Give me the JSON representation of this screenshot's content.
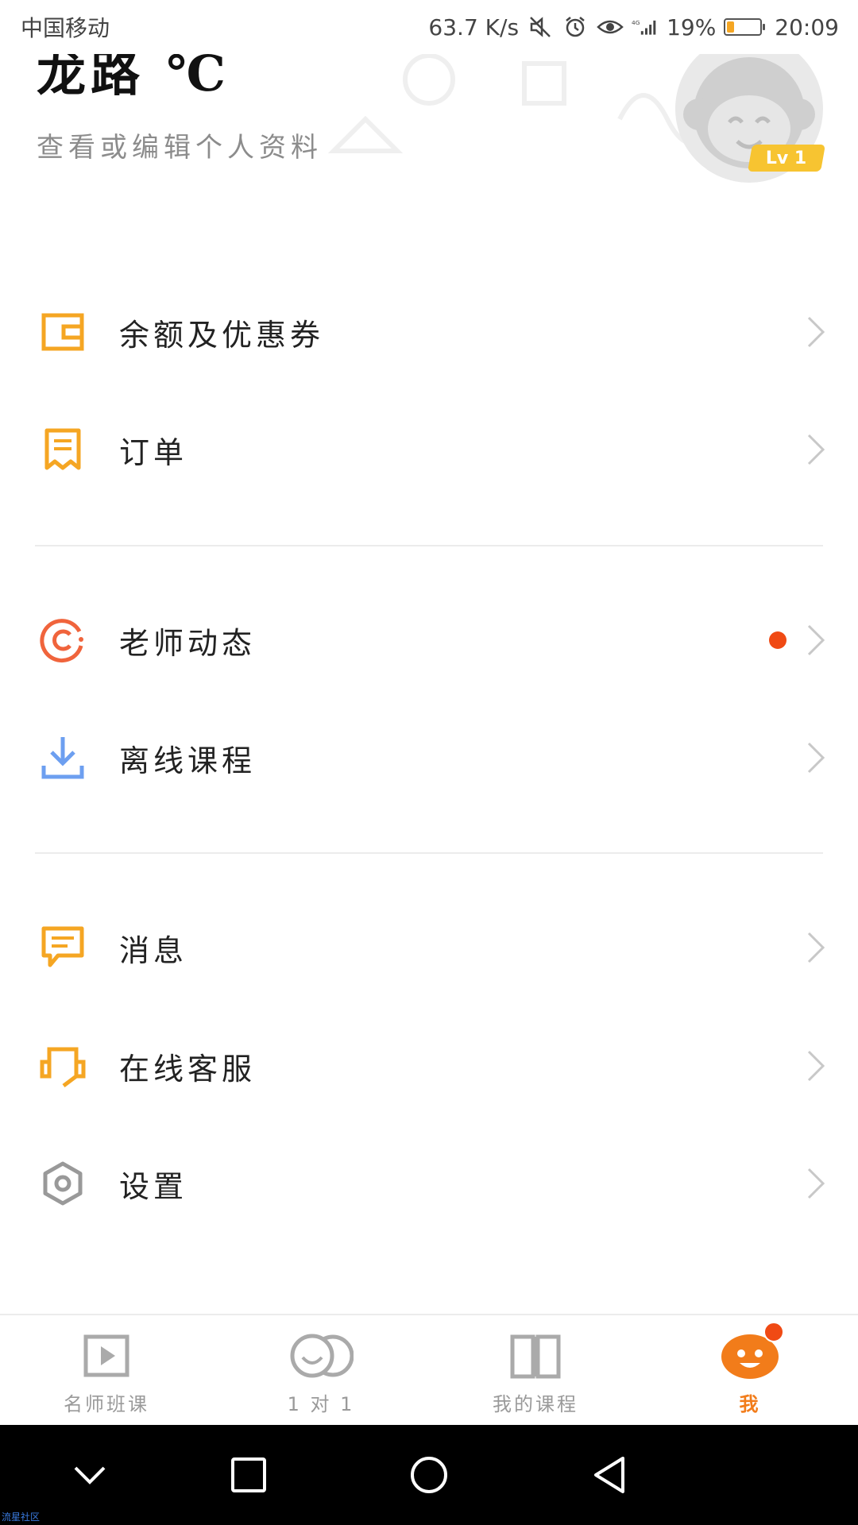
{
  "status_bar": {
    "carrier": "中国移动",
    "speed": "63.7 K/s",
    "battery_percent": "19%",
    "battery_level": 0.19,
    "time": "20:09",
    "icons": [
      "mute-icon",
      "alarm-icon",
      "eye-icon",
      "signal-4g-icon",
      "battery-icon"
    ]
  },
  "profile": {
    "username": "龙路 ℃",
    "subtitle": "查看或编辑个人资料",
    "level": "Lv 1"
  },
  "menu": {
    "items": [
      {
        "label": "余额及优惠券",
        "icon": "wallet-icon"
      },
      {
        "label": "订单",
        "icon": "receipt-icon"
      },
      {
        "label": "老师动态",
        "icon": "teacher-feed-icon",
        "has_dot": true
      },
      {
        "label": "离线课程",
        "icon": "download-icon"
      },
      {
        "label": "消息",
        "icon": "message-icon"
      },
      {
        "label": "在线客服",
        "icon": "customer-service-icon"
      },
      {
        "label": "设置",
        "icon": "settings-icon"
      }
    ]
  },
  "tabbar": {
    "tabs": [
      {
        "label": "名师班课",
        "icon": "play-video-icon",
        "active": false
      },
      {
        "label": "1 对 1",
        "icon": "one-on-one-icon",
        "active": false
      },
      {
        "label": "我的课程",
        "icon": "book-icon",
        "active": false
      },
      {
        "label": "我",
        "icon": "mascot-face-icon",
        "active": true,
        "badge": true
      }
    ]
  },
  "watermark": "流星社区",
  "colors": {
    "accent": "#f5a623",
    "active_tab": "#f27c1a",
    "badge": "#f04a14",
    "offline_icon": "#6d9ff0"
  }
}
